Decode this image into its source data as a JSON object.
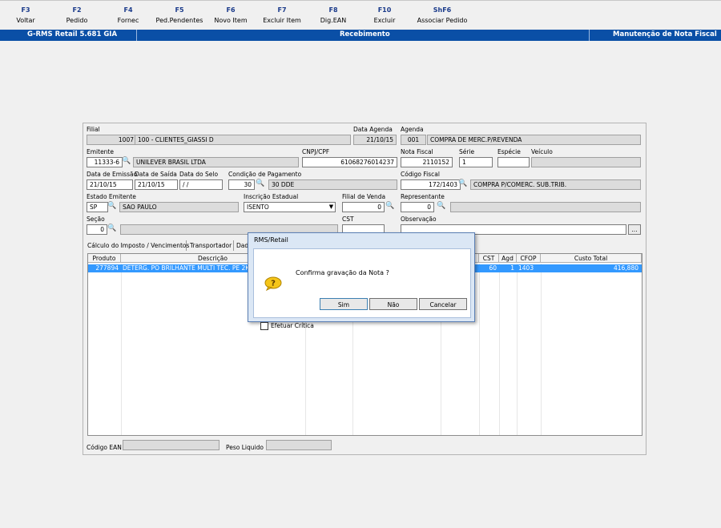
{
  "toolbar": {
    "keys": [
      {
        "key": "F3",
        "label": "Voltar"
      },
      {
        "key": "F2",
        "label": "Pedido"
      },
      {
        "key": "F4",
        "label": "Fornec"
      },
      {
        "key": "F5",
        "label": "Ped.Pendentes"
      },
      {
        "key": "F6",
        "label": "Novo Item"
      },
      {
        "key": "F7",
        "label": "Excluir Item"
      },
      {
        "key": "F8",
        "label": "Dig.EAN"
      },
      {
        "key": "F10",
        "label": "Excluir"
      },
      {
        "key": "ShF6",
        "label": "Associar Pedido"
      }
    ]
  },
  "header": {
    "app": "G-RMS Retail 5.681 GIA",
    "module": "Recebimento",
    "screen": "Manutenção de Nota Fiscal"
  },
  "form": {
    "filial_label": "Filial",
    "filial_code": "1007",
    "filial_name": "100 - CLIENTES_GIASSI D",
    "data_agenda_label": "Data Agenda",
    "data_agenda": "21/10/15",
    "agenda_label": "Agenda",
    "agenda_code": "001",
    "agenda_desc": "COMPRA DE MERC.P/REVENDA",
    "emitente_label": "Emitente",
    "emitente_code": "11333-6",
    "emitente_name": "UNILEVER BRASIL LTDA",
    "cnpj_label": "CNPJ/CPF",
    "cnpj": "61068276014237",
    "nota_label": "Nota Fiscal",
    "nota": "2110152",
    "serie_label": "Série",
    "serie": "1",
    "especie_label": "Espécie",
    "especie": "",
    "veiculo_label": "Veículo",
    "veiculo": "",
    "emissao_label": "Data de Emissão",
    "emissao": "21/10/15",
    "saida_label": "Data de Saída",
    "saida": "21/10/15",
    "selo_label": "Data do Selo",
    "selo": " /  /",
    "cond_label": "Condição de Pagamento",
    "cond_code": "30",
    "cond_desc": "30 DDE",
    "cfiscal_label": "Código Fiscal",
    "cfiscal_code": "172/1403",
    "cfiscal_desc": "COMPRA P/COMERC. SUB.TRIB.",
    "estado_label": "Estado Emitente",
    "estado_uf": "SP",
    "estado_nome": "SAO PAULO",
    "ie_label": "Inscrição Estadual",
    "ie": "ISENTO",
    "filial_venda_label": "Filial de Venda",
    "filial_venda": "0",
    "repr_label": "Representante",
    "repr": "0",
    "secao_label": "Seção",
    "secao": "0",
    "cst_label": "CST",
    "obs_label": "Observação",
    "obs_btn": "...",
    "ean_label": "Código EAN",
    "peso_label": "Peso Liquido"
  },
  "tabs": [
    "Cálculo do Imposto / Vencimentos",
    "Transportador",
    "Dado"
  ],
  "grid": {
    "columns": [
      "Produto",
      "Descrição",
      "CST",
      "Agd",
      "CFOP",
      "Custo Total"
    ],
    "row": {
      "produto": "277894",
      "descricao": "DETERG. PO BRILHANTE MULTI TEC. PE  2KG",
      "cst": "60",
      "agd": "1",
      "cfop": "1403",
      "custo": "416,880"
    }
  },
  "dialog": {
    "title": "RMS/Retail",
    "message": "Confirma gravação da Nota ?",
    "checkbox": "Efetuar Crítica",
    "yes": "Sim",
    "no": "Não",
    "cancel": "Cancelar"
  },
  "colors": {
    "header_bg": "#0a4fa6",
    "selection": "#3399ff"
  }
}
